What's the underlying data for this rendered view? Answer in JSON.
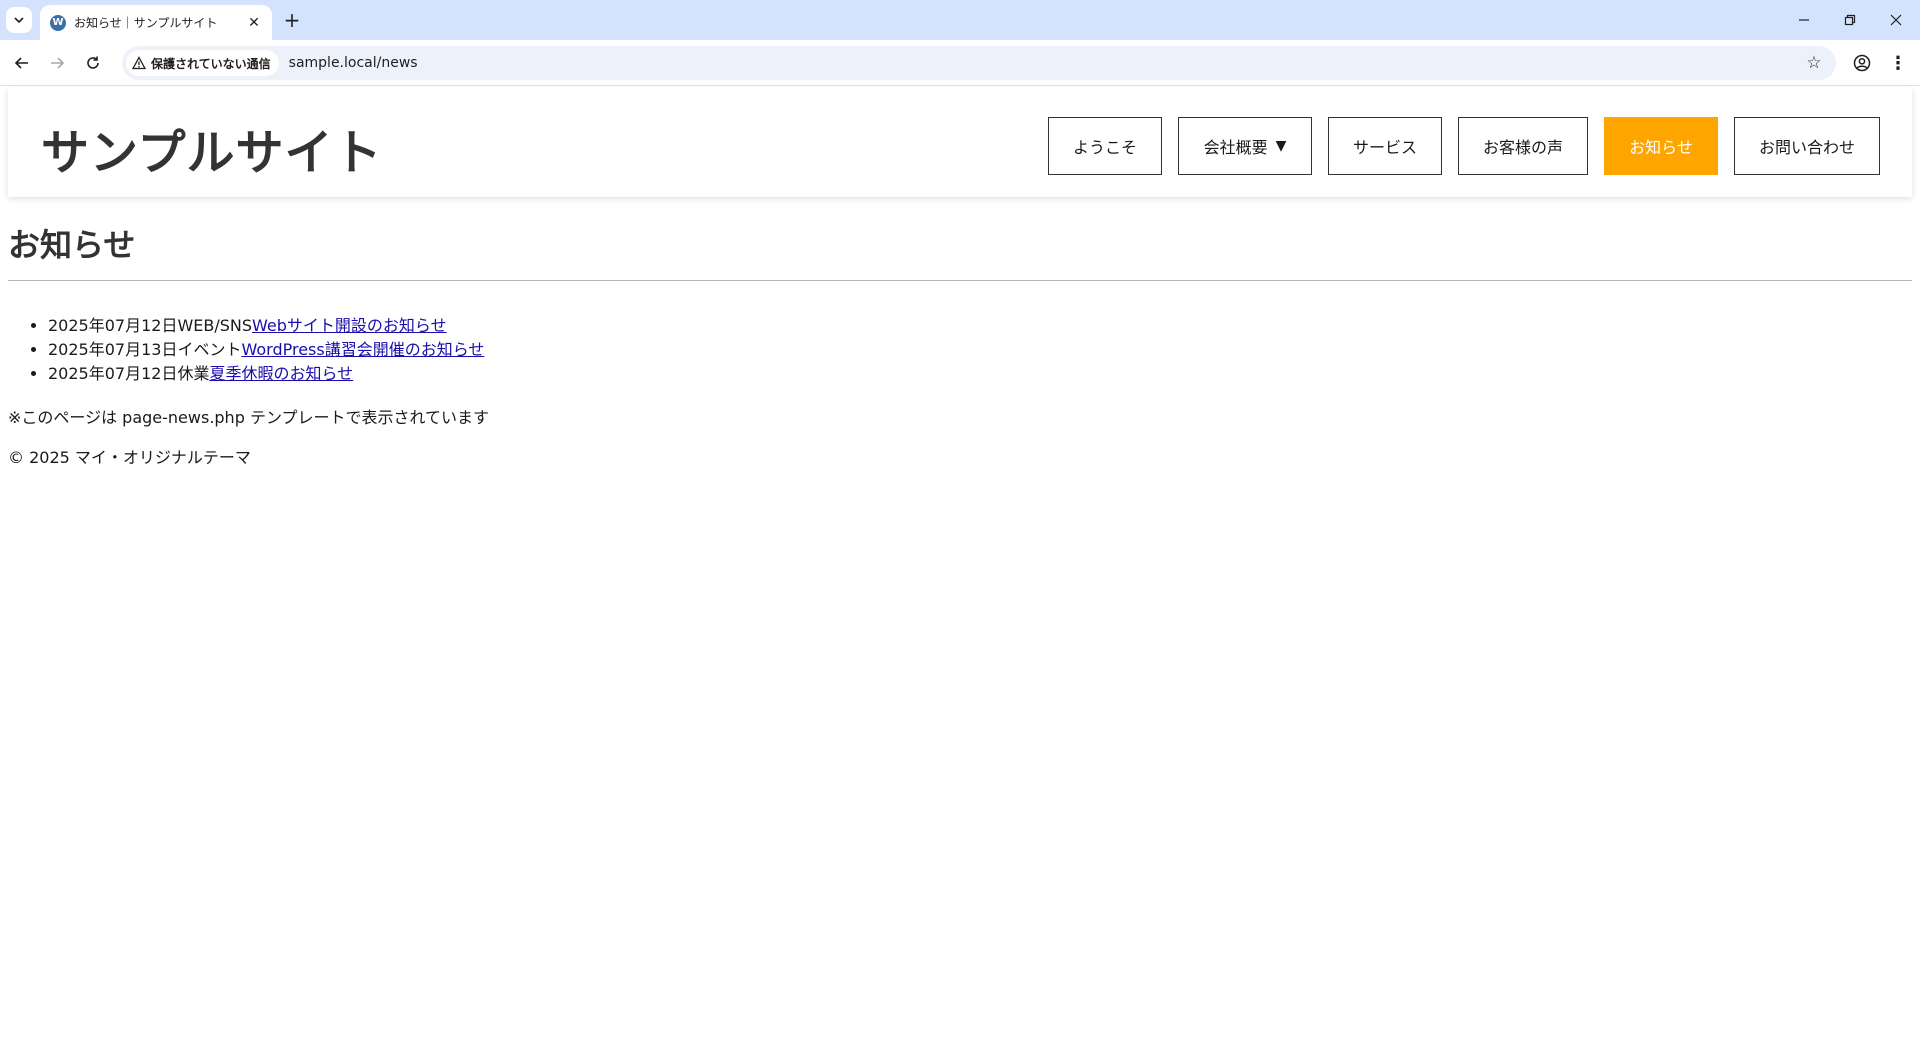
{
  "browser": {
    "tab_title": "お知らせ｜サンプルサイト",
    "security_label": "保護されていない通信",
    "url": "sample.local/news"
  },
  "site": {
    "title": "サンプルサイト",
    "nav": [
      {
        "label": "ようこそ",
        "active": false
      },
      {
        "label": "会社概要",
        "active": false,
        "has_dropdown": true
      },
      {
        "label": "サービス",
        "active": false
      },
      {
        "label": "お客様の声",
        "active": false
      },
      {
        "label": "お知らせ",
        "active": true
      },
      {
        "label": "お問い合わせ",
        "active": false
      }
    ],
    "accent_color": "#ffa500"
  },
  "main": {
    "heading": "お知らせ",
    "news": [
      {
        "date": "2025年07月12日",
        "category": "WEB/SNS",
        "title": "Webサイト開設のお知らせ"
      },
      {
        "date": "2025年07月13日",
        "category": "イベント",
        "title": "WordPress講習会開催のお知らせ"
      },
      {
        "date": "2025年07月12日",
        "category": "休業",
        "title": "夏季休暇のお知らせ"
      }
    ],
    "template_note": "※このページは page-news.php テンプレートで表示されています"
  },
  "footer": {
    "text": "© 2025 マイ・オリジナルテーマ"
  }
}
